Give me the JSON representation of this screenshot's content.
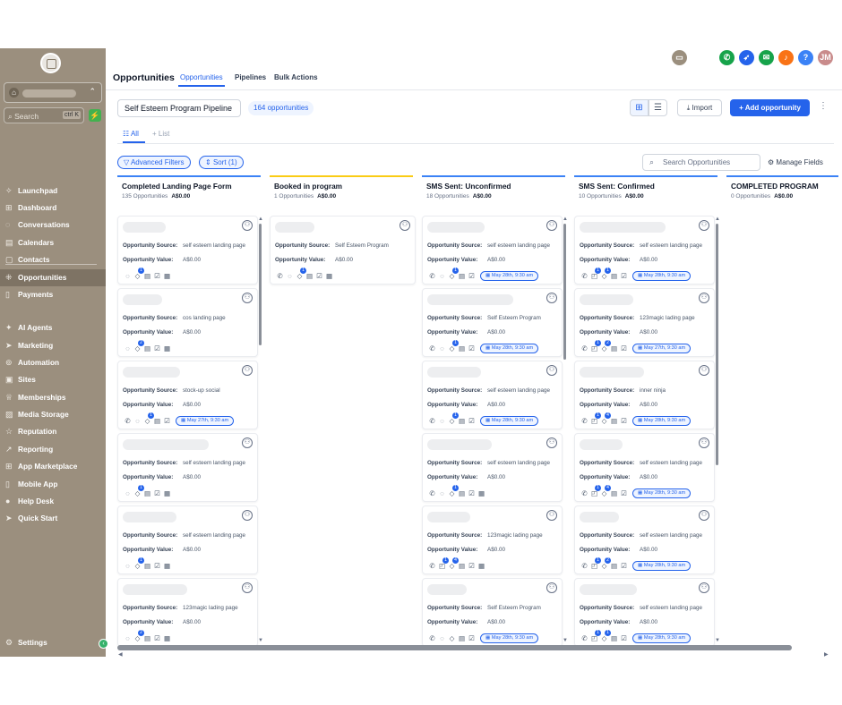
{
  "sidebar": {
    "search_placeholder": "Search",
    "search_shortcut": "ctrl K",
    "flash_icon": "lightning-icon",
    "nav": [
      {
        "label": "Launchpad",
        "icon": "rocket-icon"
      },
      {
        "label": "Dashboard",
        "icon": "grid-icon"
      },
      {
        "label": "Conversations",
        "icon": "chat-icon"
      },
      {
        "label": "Calendars",
        "icon": "calendar-icon"
      },
      {
        "label": "Contacts",
        "icon": "contacts-icon"
      },
      {
        "label": "Opportunities",
        "icon": "funnel-icon",
        "active": true
      },
      {
        "label": "Payments",
        "icon": "receipt-icon"
      },
      {
        "label": "AI Agents",
        "icon": "sparkle-icon"
      },
      {
        "label": "Marketing",
        "icon": "send-icon"
      },
      {
        "label": "Automation",
        "icon": "automation-icon"
      },
      {
        "label": "Sites",
        "icon": "sites-icon"
      },
      {
        "label": "Memberships",
        "icon": "trophy-icon"
      },
      {
        "label": "Media Storage",
        "icon": "image-icon"
      },
      {
        "label": "Reputation",
        "icon": "star-icon"
      },
      {
        "label": "Reporting",
        "icon": "chart-icon"
      },
      {
        "label": "App Marketplace",
        "icon": "apps-icon"
      },
      {
        "label": "Mobile App",
        "icon": "phone-icon"
      },
      {
        "label": "Help Desk",
        "icon": "help-icon"
      },
      {
        "label": "Quick Start",
        "icon": "send-icon"
      }
    ],
    "settings_label": "Settings"
  },
  "header": {
    "title": "Opportunities",
    "tabs": [
      "Opportunities",
      "Pipelines",
      "Bulk Actions"
    ],
    "avatar_initials": "JM",
    "colors": {
      "call": "#16a34a",
      "accent": "#2563eb",
      "orange": "#f97316",
      "help": "#3b82f6",
      "avatar": "#c98b8b",
      "sidebar": "#9b8f7e"
    }
  },
  "toolbar": {
    "pipeline": "Self Esteem Program Pipeline",
    "opportunities_count": "164 opportunities",
    "import_label": "Import",
    "add_label": "Add opportunity",
    "view_all": "All",
    "view_list": "+ List",
    "filters_label": "Advanced Filters",
    "sort_label": "Sort (1)",
    "search_placeholder": "Search Opportunities",
    "manage_fields": "Manage Fields"
  },
  "labels": {
    "source": "Opportunity Source:",
    "value": "Opportunity Value:"
  },
  "columns": [
    {
      "title": "Completed Landing Page Form",
      "count": "135 Opportunities",
      "amount": "A$0.00",
      "color": "#3b82f6",
      "cards": [
        {
          "source": "self esteem landing page",
          "value": "A$0.00",
          "icons": [
            "chat",
            "tag:1",
            "doc",
            "check",
            "cal"
          ]
        },
        {
          "source": "cos landing page",
          "value": "A$0.00",
          "icons": [
            "chat",
            "tag:2",
            "doc",
            "check",
            "cal"
          ]
        },
        {
          "source": "stock-up social",
          "value": "A$0.00",
          "icons": [
            "phone",
            "chat",
            "tag:1",
            "doc",
            "check"
          ],
          "appt": "May 27th, 9:30 am"
        },
        {
          "source": "self esteem landing page",
          "value": "A$0.00",
          "icons": [
            "chat",
            "tag:1",
            "doc",
            "check",
            "cal"
          ]
        },
        {
          "source": "self esteem landing page",
          "value": "A$0.00",
          "icons": [
            "chat",
            "tag:1",
            "doc",
            "check",
            "cal"
          ]
        },
        {
          "source": "123magic lading page",
          "value": "A$0.00",
          "icons": [
            "chat",
            "tag:2",
            "doc",
            "check",
            "cal"
          ]
        }
      ]
    },
    {
      "title": "Booked in program",
      "count": "1 Opportunities",
      "amount": "A$0.00",
      "color": "#facc15",
      "cards": [
        {
          "source": "Self Esteem Program",
          "value": "A$0.00",
          "icons": [
            "phone",
            "chat",
            "tag:1",
            "doc",
            "check",
            "cal"
          ]
        }
      ]
    },
    {
      "title": "SMS Sent: Unconfirmed",
      "count": "18 Opportunities",
      "amount": "A$0.00",
      "color": "#3b82f6",
      "cards": [
        {
          "source": "self esteem landing page",
          "value": "A$0.00",
          "icons": [
            "phone",
            "chat",
            "tag:1",
            "doc",
            "check"
          ],
          "appt": "May 28th, 9:30 am"
        },
        {
          "source": "Self Esteem Program",
          "value": "A$0.00",
          "icons": [
            "phone",
            "chat",
            "tag:1",
            "doc",
            "check"
          ],
          "appt": "May 28th, 9:30 am"
        },
        {
          "source": "self esteem landing page",
          "value": "A$0.00",
          "icons": [
            "phone",
            "chat",
            "tag:1",
            "doc",
            "check"
          ],
          "appt": "May 28th, 9:30 am"
        },
        {
          "source": "self esteem landing page",
          "value": "A$0.00",
          "icons": [
            "phone",
            "chat",
            "tag:1",
            "doc",
            "check",
            "cal"
          ]
        },
        {
          "source": "123magic lading page",
          "value": "A$0.00",
          "icons": [
            "phone",
            "msg:1",
            "tag:4",
            "doc",
            "check",
            "cal"
          ]
        },
        {
          "source": "Self Esteem Program",
          "value": "A$0.00",
          "icons": [
            "phone",
            "chat",
            "tag",
            "doc",
            "check"
          ],
          "appt": "May 28th, 9:30 am"
        }
      ]
    },
    {
      "title": "SMS Sent: Confirmed",
      "count": "10 Opportunities",
      "amount": "A$0.00",
      "color": "#3b82f6",
      "cards": [
        {
          "source": "self esteem landing page",
          "value": "A$0.00",
          "icons": [
            "phone",
            "msg:1",
            "tag:1",
            "doc",
            "check"
          ],
          "appt": "May 28th, 9:30 am"
        },
        {
          "source": "123magic lading page",
          "value": "A$0.00",
          "icons": [
            "phone",
            "msg:1",
            "tag:2",
            "doc",
            "check"
          ],
          "appt": "May 27th, 9:30 am"
        },
        {
          "source": "inner ninja",
          "value": "A$0.00",
          "icons": [
            "phone",
            "msg:1",
            "tag:4",
            "doc",
            "check"
          ],
          "appt": "May 28th, 9:30 am"
        },
        {
          "source": "self esteem landing page",
          "value": "A$0.00",
          "icons": [
            "phone",
            "msg:1",
            "tag:4",
            "doc",
            "check"
          ],
          "appt": "May 28th, 9:30 am"
        },
        {
          "source": "self esteem landing page",
          "value": "A$0.00",
          "icons": [
            "phone",
            "msg:1",
            "tag:2",
            "doc",
            "check"
          ],
          "appt": "May 28th, 9:30 am"
        },
        {
          "source": "self esteem landing page",
          "value": "A$0.00",
          "icons": [
            "phone",
            "msg:1",
            "tag:1",
            "doc",
            "check"
          ],
          "appt": "May 28th, 9:30 am"
        }
      ]
    },
    {
      "title": "COMPLETED PROGRAM",
      "count": "0 Opportunities",
      "amount": "A$0.00",
      "color": "#3b82f6",
      "cards": []
    }
  ]
}
